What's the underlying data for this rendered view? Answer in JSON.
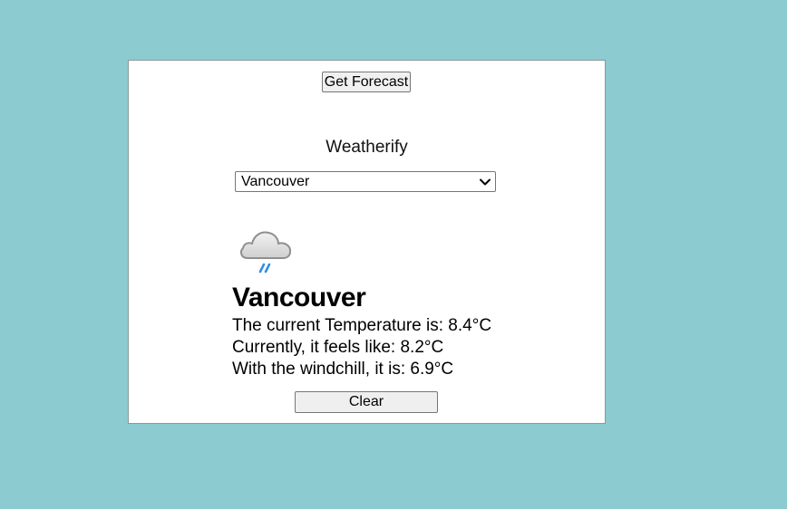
{
  "toolbar": {
    "get_forecast_label": "Get Forecast"
  },
  "app": {
    "title": "Weatherify"
  },
  "city_select": {
    "selected": "Vancouver"
  },
  "forecast": {
    "icon": "rain-cloud-icon",
    "city": "Vancouver",
    "temperature_text": "The current Temperature is: 8.4°C",
    "feels_like_text": "Currently, it feels like: 8.2°C",
    "windchill_text": "With the windchill, it is: 6.9°C"
  },
  "actions": {
    "clear_label": "Clear"
  },
  "colors": {
    "background": "#8ccbd0",
    "card": "#ffffff",
    "rain": "#2f8fe6",
    "cloud": "#d9d9d9"
  }
}
